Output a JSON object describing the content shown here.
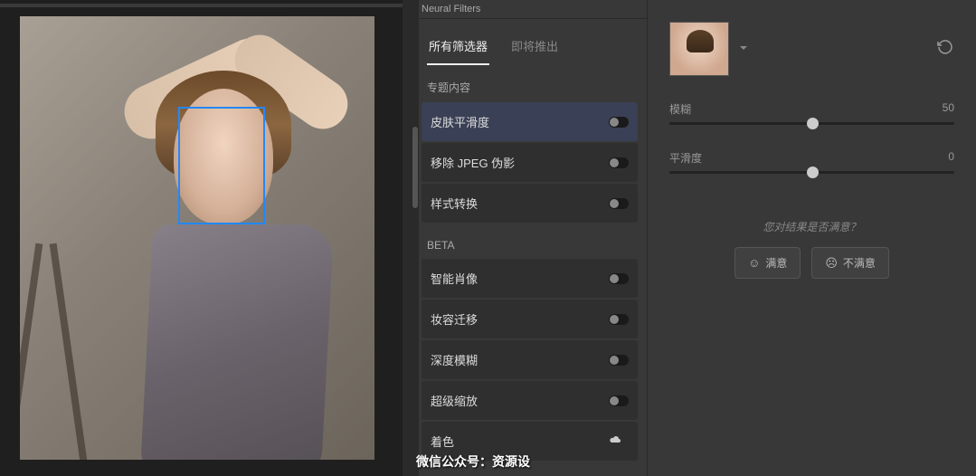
{
  "panel_title": "Neural Filters",
  "tabs": {
    "all": "所有筛选器",
    "coming": "即将推出"
  },
  "sections": {
    "featured": "专题内容",
    "beta": "BETA"
  },
  "filters": {
    "skin": "皮肤平滑度",
    "jpeg": "移除 JPEG 伪影",
    "style": "样式转换",
    "portrait": "智能肖像",
    "makeup": "妆容迁移",
    "depth": "深度模糊",
    "zoom": "超级缩放",
    "last": "着色"
  },
  "sliders": {
    "blur": {
      "label": "模糊",
      "value": "50",
      "pos": 50
    },
    "smooth": {
      "label": "平滑度",
      "value": "0",
      "pos": 50
    }
  },
  "feedback": {
    "question": "您对结果是否满意？",
    "yes": "满意",
    "no": "不满意"
  },
  "watermark": "微信公众号：资源设"
}
